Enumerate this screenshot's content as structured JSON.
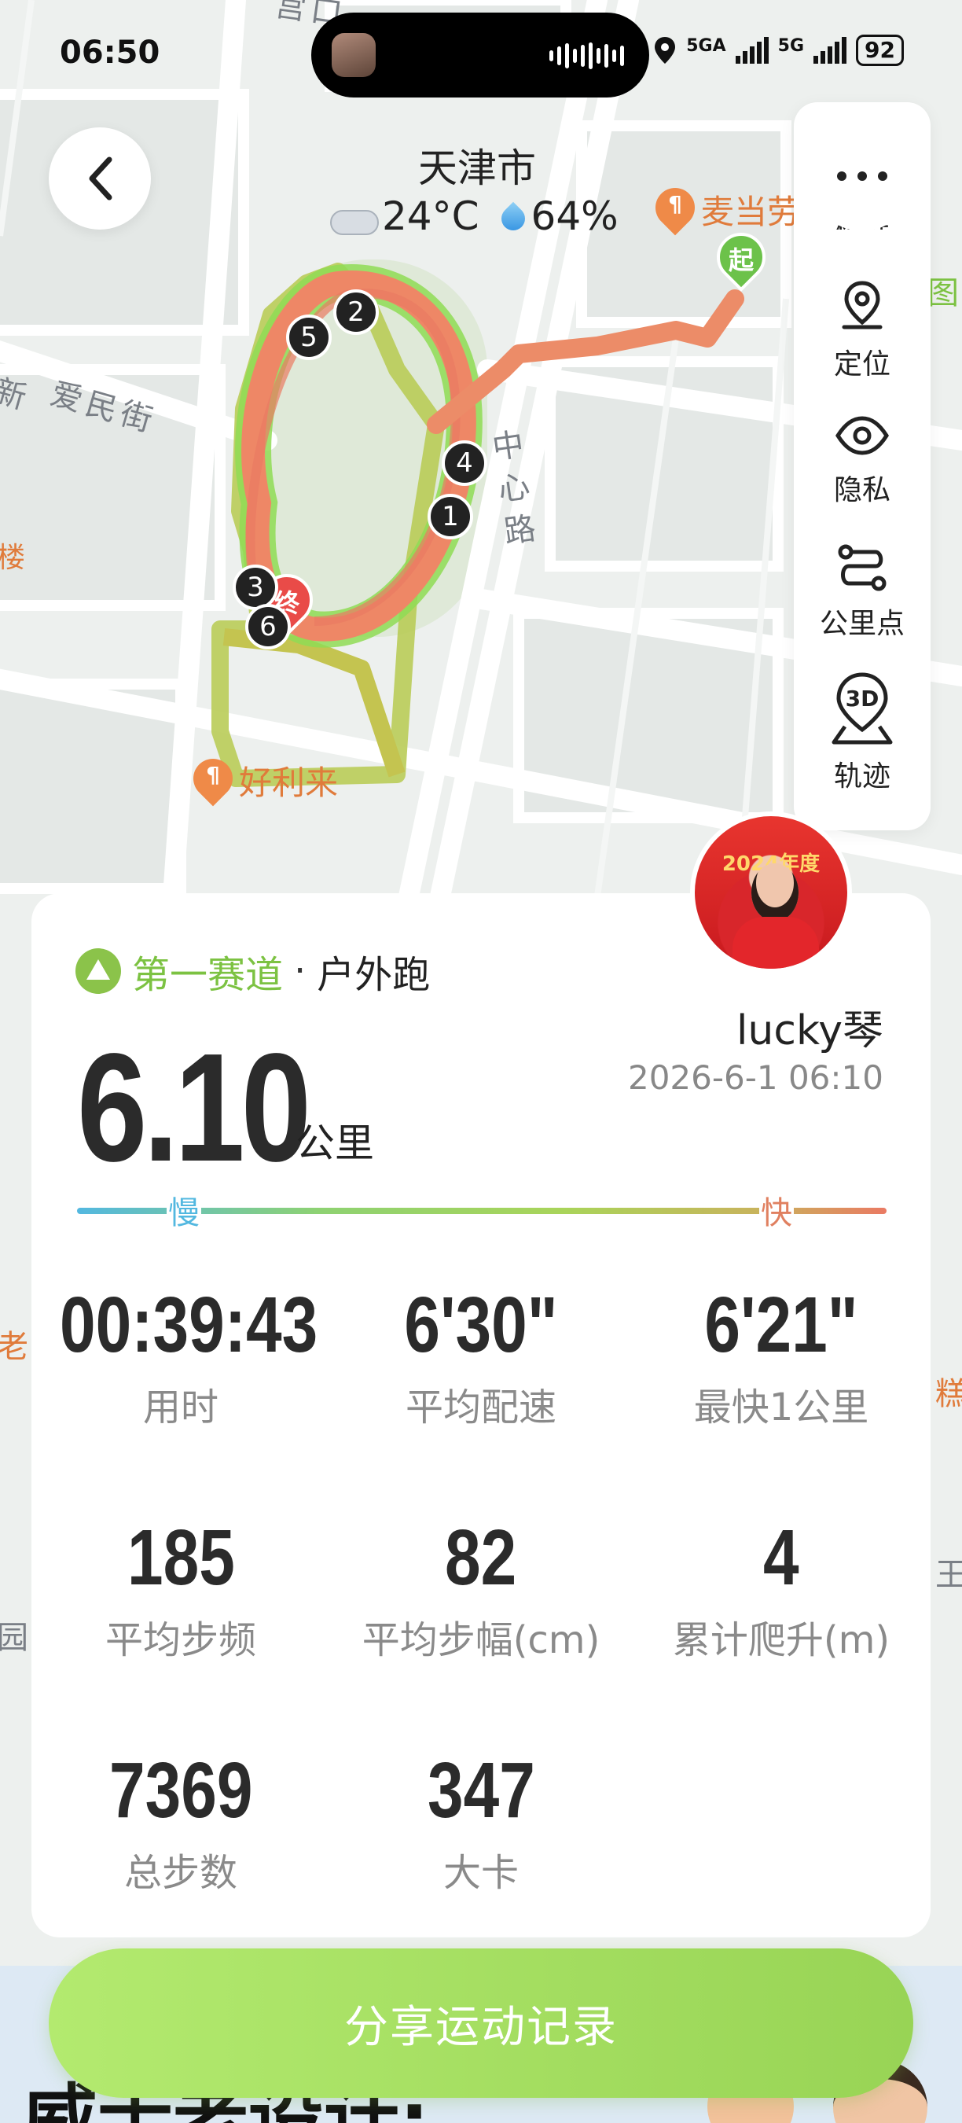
{
  "status_bar": {
    "time": "06:50",
    "network1": "5GA",
    "network2": "5G",
    "battery": "92"
  },
  "map": {
    "city": "天津市",
    "temperature": "24°C",
    "humidity": "64%",
    "street_labels": [
      "新",
      "爱民街",
      "中心路",
      "宫口"
    ],
    "pois": [
      "麦当劳",
      "好利来"
    ],
    "edge_fragments": [
      "老",
      "糕",
      "王",
      "园",
      "图",
      "楼"
    ],
    "start_label": "起",
    "end_label": "终",
    "km_markers": [
      "1",
      "2",
      "3",
      "4",
      "5",
      "6"
    ]
  },
  "side_menu": {
    "items": [
      {
        "label": "标准",
        "icon": "layers-icon"
      },
      {
        "label": "定位",
        "icon": "location-icon"
      },
      {
        "label": "隐私",
        "icon": "eye-icon"
      },
      {
        "label": "公里点",
        "icon": "route-icon"
      },
      {
        "label": "轨迹",
        "icon": "3d-track-icon"
      }
    ],
    "icon_3d_text": "3D"
  },
  "activity": {
    "brand": "第一赛道",
    "separator": "·",
    "type": "户外跑",
    "username": "lucky琴",
    "datetime": "2026-6-1 06:10",
    "distance": "6.10",
    "distance_unit": "公里",
    "pace_slow": "慢",
    "pace_fast": "快",
    "avatar_banner": "2024年度"
  },
  "stats": [
    {
      "value": "00:39:43",
      "label": "用时"
    },
    {
      "value": "6'30\"",
      "label": "平均配速"
    },
    {
      "value": "6'21\"",
      "label": "最快1公里"
    },
    {
      "value": "185",
      "label": "平均步频"
    },
    {
      "value": "82",
      "label": "平均步幅(cm)"
    },
    {
      "value": "4",
      "label": "累计爬升(m)"
    },
    {
      "value": "7369",
      "label": "总步数"
    },
    {
      "value": "347",
      "label": "大卡"
    }
  ],
  "share": {
    "label": "分享运动记录"
  },
  "promo": {
    "text": "威士老设计:"
  },
  "colors": {
    "accent": "#7cc242",
    "share_start": "#b3ea6f",
    "share_end": "#98d455",
    "route_fast": "#ea7a63",
    "route_slow": "#a9d45a"
  }
}
